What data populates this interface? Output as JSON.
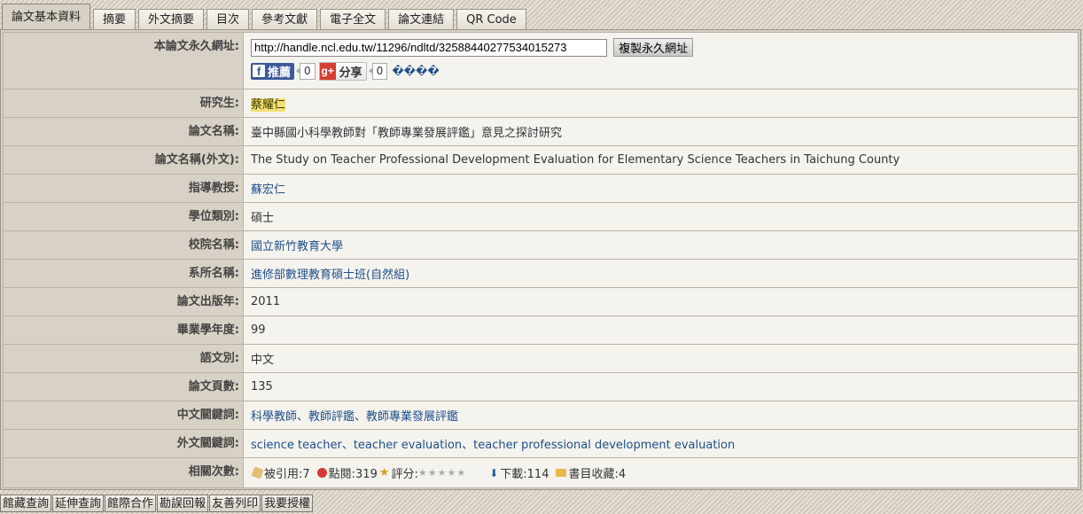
{
  "tabs": [
    {
      "label": "論文基本資料",
      "active": true
    },
    {
      "label": "摘要"
    },
    {
      "label": "外文摘要"
    },
    {
      "label": "目次"
    },
    {
      "label": "參考文獻"
    },
    {
      "label": "電子全文"
    },
    {
      "label": "論文連結"
    },
    {
      "label": "QR Code"
    }
  ],
  "permalink": {
    "label": "本論文永久網址:",
    "url": "http://handle.ncl.edu.tw/11296/ndltd/32588440277534015273",
    "copy_button": "複製永久網址"
  },
  "social": {
    "facebook_label": "推薦",
    "facebook_count": "0",
    "google_label": "分享",
    "google_count": "0",
    "garbled_text": "����"
  },
  "fields": [
    {
      "label": "研究生:",
      "value": "蔡耀仁"
    },
    {
      "label": "論文名稱:",
      "value": "臺中縣國小科學教師對「教師專業發展評鑑」意見之探討研究"
    },
    {
      "label": "論文名稱(外文):",
      "value": "The Study on Teacher Professional Development Evaluation for Elementary Science Teachers in Taichung County"
    },
    {
      "label": "指導教授:",
      "value": "蘇宏仁"
    },
    {
      "label": "學位類別:",
      "value": "碩士"
    },
    {
      "label": "校院名稱:",
      "value": "國立新竹教育大學"
    },
    {
      "label": "系所名稱:",
      "value": "進修部數理教育碩士班(自然組)"
    },
    {
      "label": "論文出版年:",
      "value": "2011"
    },
    {
      "label": "畢業學年度:",
      "value": "99"
    },
    {
      "label": "語文別:",
      "value": "中文"
    },
    {
      "label": "論文頁數:",
      "value": "135"
    },
    {
      "label": "中文關鍵詞:",
      "value": "科學教師、教師評鑑、教師專業發展評鑑"
    },
    {
      "label": "外文關鍵詞:",
      "value": "science teacher、teacher evaluation、teacher professional development evaluation"
    }
  ],
  "stats": {
    "label": "相關次數:",
    "cited": "被引用:7",
    "views": "點閱:319",
    "rating_label": "評分:",
    "rating_stars": "★★★★★",
    "downloads": "下載:114",
    "bookmarks": "書目收藏:4"
  },
  "bottom_buttons": [
    "館藏查詢",
    "延伸查詢",
    "館際合作",
    "勘誤回報",
    "友善列印",
    "我要授權"
  ]
}
